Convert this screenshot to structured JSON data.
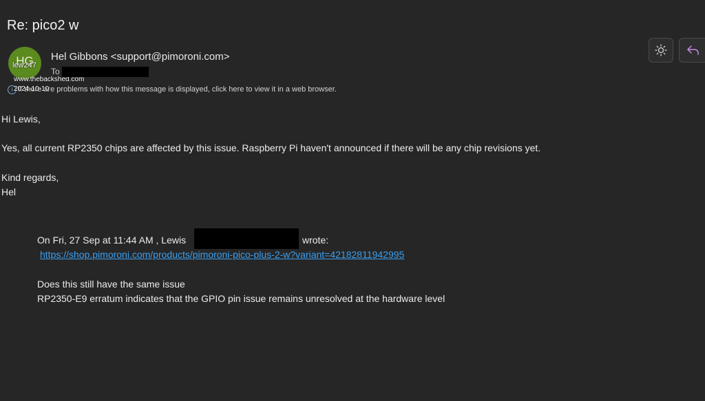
{
  "email": {
    "subject": "Re: pico2 w",
    "sender": "Hel Gibbons <support@pimoroni.com>",
    "avatar_initials": "HG",
    "to_label": "To",
    "info_bar": "If there are problems with how this message is displayed, click here to view it in a web browser.",
    "greeting": "Hi Lewis,",
    "body_line": "Yes, all current RP2350 chips are affected by this issue. Raspberry Pi haven't announced if there will be any chip revisions yet.",
    "closing": "Kind regards,",
    "signature": "Hel"
  },
  "quoted": {
    "header_prefix": "On Fri, 27 Sep at 11:44 AM , Lewis",
    "header_suffix": "wrote:",
    "link": "https://shop.pimoroni.com/products/pimoroni-pico-plus-2-w?variant=42182811942995",
    "line1": "Does this still have the same issue",
    "line2": "RP2350-E9 erratum indicates that the GPIO pin issue remains unresolved at the hardware level"
  },
  "watermark": {
    "user": "lew247",
    "site": "www.thebackshed.com",
    "date": "2024-10-10"
  },
  "toolbar": {
    "theme_icon": "sun-icon",
    "reply_icon": "reply-arrow-icon"
  },
  "colors": {
    "background": "#262626",
    "avatar": "#5b8a1e",
    "link": "#3aa0f2",
    "reply_accent": "#c48fe0"
  }
}
